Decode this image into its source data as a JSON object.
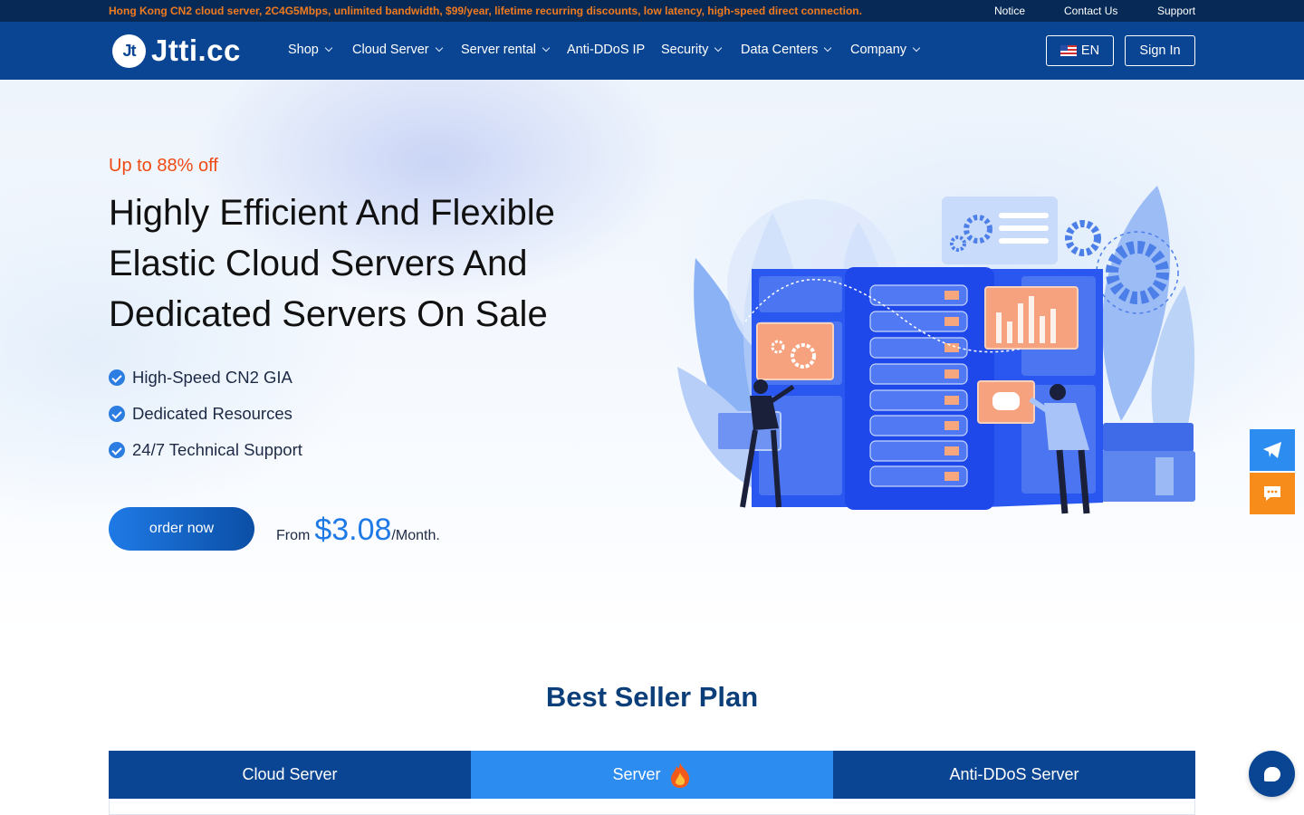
{
  "topbar": {
    "promo": "Hong Kong CN2 cloud server, 2C4G5Mbps, unlimited bandwidth, $99/year, lifetime recurring discounts, low latency, high-speed direct connection.",
    "links": [
      "Notice",
      "Contact Us",
      "Support"
    ]
  },
  "nav": {
    "logo_mark": "Jt",
    "logo_text": "Jtti.cc",
    "items": [
      {
        "label": "Shop",
        "icon": "chevron-down-icon"
      },
      {
        "label": "Cloud Server",
        "icon": "chevron-down-icon"
      },
      {
        "label": "Server rental",
        "icon": "chevron-down-icon"
      },
      {
        "label": "Anti-DDoS IP"
      },
      {
        "label": "Security",
        "icon": "chevron-down-icon"
      },
      {
        "label": "Data Centers",
        "icon": "chevron-down-icon"
      },
      {
        "label": "Company",
        "icon": "chevron-down-icon"
      }
    ],
    "language_label": "EN",
    "language_icon": "us-flag-icon",
    "signin_label": "Sign In"
  },
  "hero": {
    "eyebrow": "Up to 88% off",
    "headline": "Highly Efficient And Flexible Elastic Cloud Servers And Dedicated Servers On Sale",
    "features": [
      "High-Speed CN2 GIA",
      "Dedicated Resources",
      "24/7 Technical Support"
    ],
    "order_label": "order now",
    "price_prefix": "From",
    "price": "$3.08",
    "price_suffix": "/Month.",
    "illustration": "server-racks-illustration"
  },
  "side_buttons": [
    {
      "icon": "telegram-icon",
      "color": "#2d8cf0"
    },
    {
      "icon": "message-icon",
      "color": "#f78c1b"
    }
  ],
  "chat_icon": "chat-bubble-icon",
  "best_seller": {
    "title": "Best Seller Plan",
    "tabs": [
      {
        "label": "Cloud Server",
        "active": false
      },
      {
        "label": "Server",
        "active": true,
        "icon": "fire-icon"
      },
      {
        "label": "Anti-DDoS Server",
        "active": false
      }
    ]
  },
  "colors": {
    "topbar_bg": "#062a55",
    "nav_bg": "#0a4593",
    "accent_blue": "#2d8cf0",
    "promo_orange": "#f07a1f",
    "eyebrow_red": "#ef4a14",
    "side_orange": "#f78c1b"
  }
}
